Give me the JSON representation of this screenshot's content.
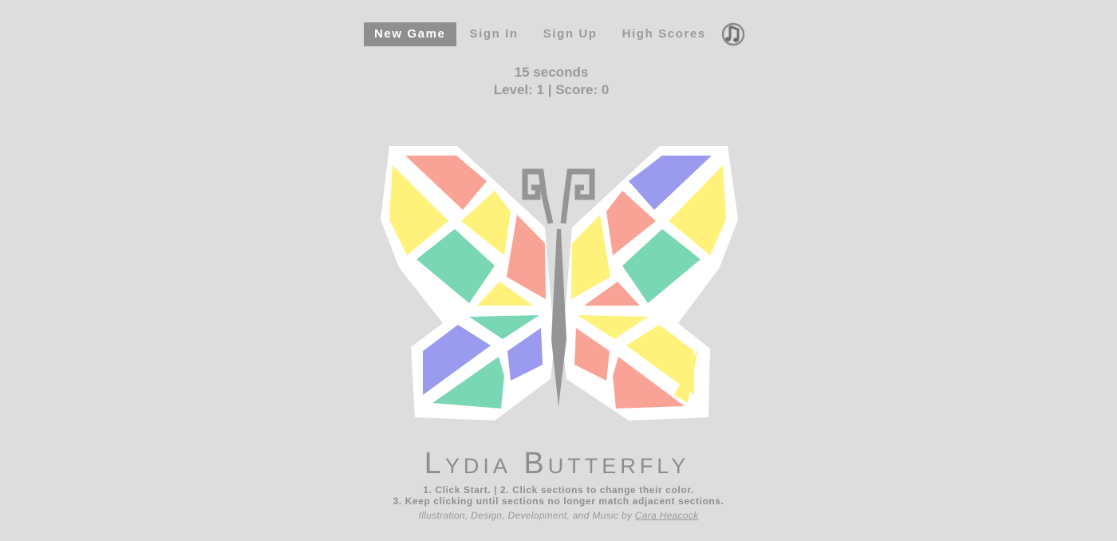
{
  "nav": {
    "new_game": "New Game",
    "sign_in": "Sign In",
    "sign_up": "Sign Up",
    "high_scores": "High Scores",
    "music_icon": "music-note-icon"
  },
  "status": {
    "timer": "15 seconds",
    "level_score": "Level: 1 | Score: 0"
  },
  "game": {
    "colors": {
      "salmon": "#f9a397",
      "yellow": "#fff27a",
      "green": "#7ad7b3",
      "purple": "#9a9aee",
      "white": "#ffffff",
      "body": "#959595"
    },
    "sections": [
      "salmon",
      "yellow",
      "yellow",
      "green",
      "salmon",
      "yellow",
      "green",
      "purple",
      "purple",
      "green",
      "purple",
      "yellow",
      "salmon",
      "green",
      "yellow",
      "salmon",
      "yellow",
      "yellow",
      "salmon",
      "yellow",
      "salmon"
    ]
  },
  "title": "Lydia Butterfly",
  "instructions": {
    "line1": "1. Click Start. | 2. Click sections to change their color.",
    "line2": "3. Keep clicking until sections no longer match adjacent sections."
  },
  "credits": {
    "prefix": "Illustration, Design, Development, and Music by ",
    "author": "Cara Heacock"
  }
}
